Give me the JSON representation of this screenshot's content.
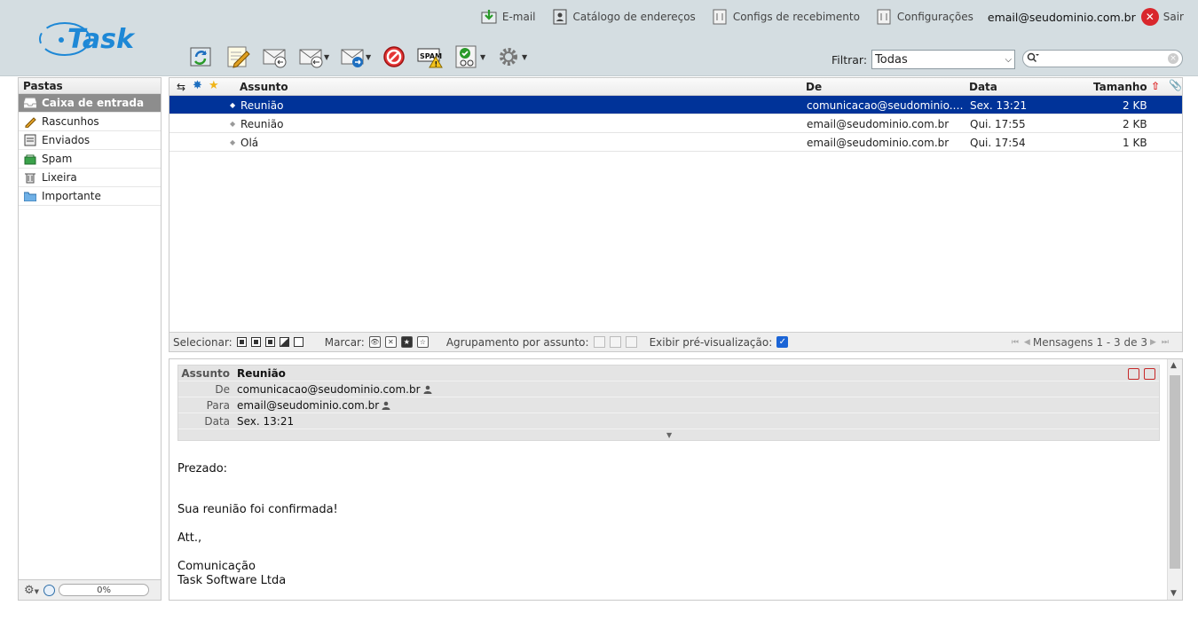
{
  "header": {
    "logo_text": "Task",
    "nav": [
      {
        "label": "E-mail",
        "icon": "email-download-icon"
      },
      {
        "label": "Catálogo de endereços",
        "icon": "address-book-icon"
      },
      {
        "label": "Configs de recebimento",
        "icon": "receive-settings-icon"
      },
      {
        "label": "Configurações",
        "icon": "settings-icon"
      }
    ],
    "user_email": "email@seudominio.com.br",
    "logout_label": "Sair"
  },
  "filter": {
    "label": "Filtrar:",
    "selected": "Todas"
  },
  "search": {
    "placeholder": ""
  },
  "folders": {
    "title": "Pastas",
    "items": [
      {
        "label": "Caixa de entrada",
        "icon": "inbox-icon",
        "selected": true
      },
      {
        "label": "Rascunhos",
        "icon": "pencil-icon",
        "selected": false
      },
      {
        "label": "Enviados",
        "icon": "sent-icon",
        "selected": false
      },
      {
        "label": "Spam",
        "icon": "spam-icon",
        "selected": false
      },
      {
        "label": "Lixeira",
        "icon": "trash-icon",
        "selected": false
      },
      {
        "label": "Importante",
        "icon": "folder-icon",
        "selected": false
      }
    ],
    "quota": "0%"
  },
  "list": {
    "columns": {
      "subject": "Assunto",
      "from": "De",
      "date": "Data",
      "size": "Tamanho"
    },
    "messages": [
      {
        "subject": "Reunião",
        "from": "comunicacao@seudominio.co...",
        "date": "Sex. 13:21",
        "size": "2 KB",
        "selected": true
      },
      {
        "subject": "Reunião",
        "from": "email@seudominio.com.br",
        "date": "Qui. 17:55",
        "size": "2 KB",
        "selected": false
      },
      {
        "subject": "Olá",
        "from": "email@seudominio.com.br",
        "date": "Qui. 17:54",
        "size": "1 KB",
        "selected": false
      }
    ],
    "footer": {
      "select_label": "Selecionar:",
      "mark_label": "Marcar:",
      "group_label": "Agrupamento por assunto:",
      "preview_label": "Exibir pré-visualização:",
      "pager_text": "Mensagens 1 - 3 de 3"
    }
  },
  "preview": {
    "labels": {
      "subject": "Assunto",
      "from": "De",
      "to": "Para",
      "date": "Data"
    },
    "subject": "Reunião",
    "from": "comunicacao@seudominio.com.br",
    "to": "email@seudominio.com.br",
    "date": "Sex. 13:21",
    "body": [
      "Prezado:",
      "Sua reunião foi confirmada!",
      "Att.,",
      "Comunicação",
      "Task Software Ltda"
    ]
  },
  "colors": {
    "header_bg": "#d4dde1",
    "selected_row": "#003399",
    "selected_folder": "#8d8d8d",
    "logo_blue": "#1e88d6",
    "logout_red": "#d9262c"
  }
}
